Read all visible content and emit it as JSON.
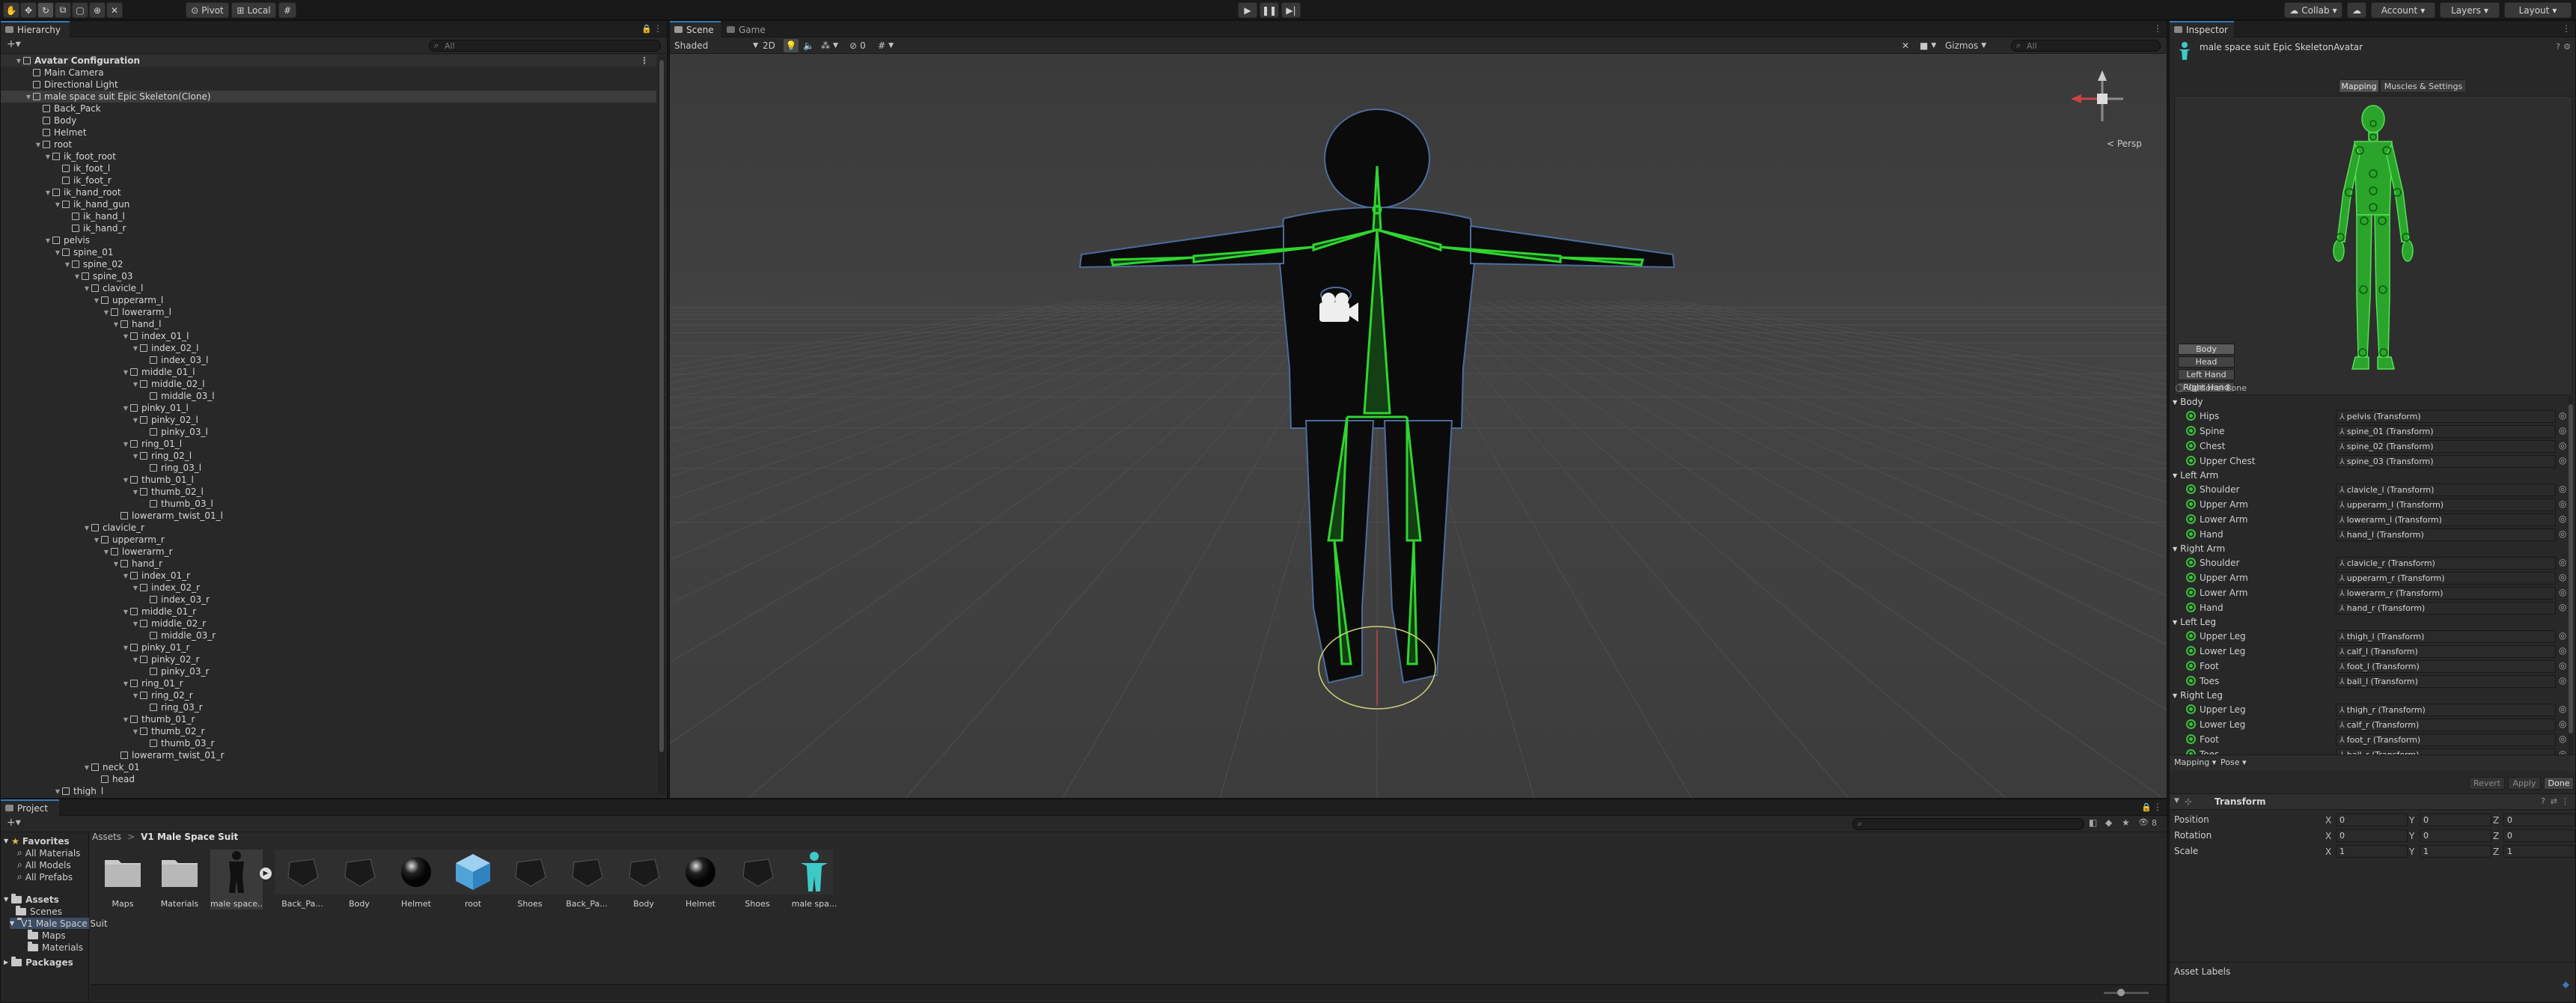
{
  "toolbar": {
    "pivot": "Pivot",
    "local": "Local",
    "collab": "Collab",
    "account": "Account",
    "layers": "Layers",
    "layout": "Layout"
  },
  "hierarchy": {
    "tab": "Hierarchy",
    "search_placeholder": "All",
    "rows": [
      {
        "label": "Avatar Configuration",
        "depth": 0,
        "arrow": "▼",
        "type": "root"
      },
      {
        "label": "Main Camera",
        "depth": 1,
        "arrow": ""
      },
      {
        "label": "Directional Light",
        "depth": 1,
        "arrow": ""
      },
      {
        "label": "male space suit Epic Skeleton(Clone)",
        "depth": 1,
        "arrow": "▼",
        "type": "sel"
      },
      {
        "label": "Back_Pack",
        "depth": 2,
        "arrow": ""
      },
      {
        "label": "Body",
        "depth": 2,
        "arrow": ""
      },
      {
        "label": "Helmet",
        "depth": 2,
        "arrow": ""
      },
      {
        "label": "root",
        "depth": 2,
        "arrow": "▼"
      },
      {
        "label": "ik_foot_root",
        "depth": 3,
        "arrow": "▼"
      },
      {
        "label": "ik_foot_l",
        "depth": 4,
        "arrow": ""
      },
      {
        "label": "ik_foot_r",
        "depth": 4,
        "arrow": ""
      },
      {
        "label": "ik_hand_root",
        "depth": 3,
        "arrow": "▼"
      },
      {
        "label": "ik_hand_gun",
        "depth": 4,
        "arrow": "▼"
      },
      {
        "label": "ik_hand_l",
        "depth": 5,
        "arrow": ""
      },
      {
        "label": "ik_hand_r",
        "depth": 5,
        "arrow": ""
      },
      {
        "label": "pelvis",
        "depth": 3,
        "arrow": "▼"
      },
      {
        "label": "spine_01",
        "depth": 4,
        "arrow": "▼"
      },
      {
        "label": "spine_02",
        "depth": 5,
        "arrow": "▼"
      },
      {
        "label": "spine_03",
        "depth": 6,
        "arrow": "▼"
      },
      {
        "label": "clavicle_l",
        "depth": 7,
        "arrow": "▼"
      },
      {
        "label": "upperarm_l",
        "depth": 8,
        "arrow": "▼"
      },
      {
        "label": "lowerarm_l",
        "depth": 9,
        "arrow": "▼"
      },
      {
        "label": "hand_l",
        "depth": 10,
        "arrow": "▼"
      },
      {
        "label": "index_01_l",
        "depth": 11,
        "arrow": "▼"
      },
      {
        "label": "index_02_l",
        "depth": 12,
        "arrow": "▼"
      },
      {
        "label": "index_03_l",
        "depth": 13,
        "arrow": ""
      },
      {
        "label": "middle_01_l",
        "depth": 11,
        "arrow": "▼"
      },
      {
        "label": "middle_02_l",
        "depth": 12,
        "arrow": "▼"
      },
      {
        "label": "middle_03_l",
        "depth": 13,
        "arrow": ""
      },
      {
        "label": "pinky_01_l",
        "depth": 11,
        "arrow": "▼"
      },
      {
        "label": "pinky_02_l",
        "depth": 12,
        "arrow": "▼"
      },
      {
        "label": "pinky_03_l",
        "depth": 13,
        "arrow": ""
      },
      {
        "label": "ring_01_l",
        "depth": 11,
        "arrow": "▼"
      },
      {
        "label": "ring_02_l",
        "depth": 12,
        "arrow": "▼"
      },
      {
        "label": "ring_03_l",
        "depth": 13,
        "arrow": ""
      },
      {
        "label": "thumb_01_l",
        "depth": 11,
        "arrow": "▼"
      },
      {
        "label": "thumb_02_l",
        "depth": 12,
        "arrow": "▼"
      },
      {
        "label": "thumb_03_l",
        "depth": 13,
        "arrow": ""
      },
      {
        "label": "lowerarm_twist_01_l",
        "depth": 10,
        "arrow": ""
      },
      {
        "label": "clavicle_r",
        "depth": 7,
        "arrow": "▼"
      },
      {
        "label": "upperarm_r",
        "depth": 8,
        "arrow": "▼"
      },
      {
        "label": "lowerarm_r",
        "depth": 9,
        "arrow": "▼"
      },
      {
        "label": "hand_r",
        "depth": 10,
        "arrow": "▼"
      },
      {
        "label": "index_01_r",
        "depth": 11,
        "arrow": "▼"
      },
      {
        "label": "index_02_r",
        "depth": 12,
        "arrow": "▼"
      },
      {
        "label": "index_03_r",
        "depth": 13,
        "arrow": ""
      },
      {
        "label": "middle_01_r",
        "depth": 11,
        "arrow": "▼"
      },
      {
        "label": "middle_02_r",
        "depth": 12,
        "arrow": "▼"
      },
      {
        "label": "middle_03_r",
        "depth": 13,
        "arrow": ""
      },
      {
        "label": "pinky_01_r",
        "depth": 11,
        "arrow": "▼"
      },
      {
        "label": "pinky_02_r",
        "depth": 12,
        "arrow": "▼"
      },
      {
        "label": "pinky_03_r",
        "depth": 13,
        "arrow": ""
      },
      {
        "label": "ring_01_r",
        "depth": 11,
        "arrow": "▼"
      },
      {
        "label": "ring_02_r",
        "depth": 12,
        "arrow": "▼"
      },
      {
        "label": "ring_03_r",
        "depth": 13,
        "arrow": ""
      },
      {
        "label": "thumb_01_r",
        "depth": 11,
        "arrow": "▼"
      },
      {
        "label": "thumb_02_r",
        "depth": 12,
        "arrow": "▼"
      },
      {
        "label": "thumb_03_r",
        "depth": 13,
        "arrow": ""
      },
      {
        "label": "lowerarm_twist_01_r",
        "depth": 10,
        "arrow": ""
      },
      {
        "label": "neck_01",
        "depth": 7,
        "arrow": "▼"
      },
      {
        "label": "head",
        "depth": 8,
        "arrow": ""
      },
      {
        "label": "thigh_l",
        "depth": 4,
        "arrow": "▼"
      }
    ]
  },
  "scene": {
    "tab_scene": "Scene",
    "tab_game": "Game",
    "shading": "Shaded",
    "mode_2d": "2D",
    "gizmos": "Gizmos",
    "search_placeholder": "All",
    "persp": "< Persp",
    "fx_count": "0",
    "grid_color": "#3b3b3b",
    "bone_color": "#2fd62f"
  },
  "inspector": {
    "tab": "Inspector",
    "title": "male space suit Epic SkeletonAvatar",
    "tab_mapping": "Mapping",
    "tab_muscles": "Muscles & Settings",
    "body_buttons": [
      "Body",
      "Head",
      "Left Hand",
      "Right Hand"
    ],
    "optional_bone": "Optional Bone",
    "groups": [
      {
        "name": "Body",
        "bones": [
          {
            "label": "Hips",
            "value": "pelvis (Transform)"
          },
          {
            "label": "Spine",
            "value": "spine_01 (Transform)"
          },
          {
            "label": "Chest",
            "value": "spine_02 (Transform)"
          },
          {
            "label": "Upper Chest",
            "value": "spine_03 (Transform)"
          }
        ]
      },
      {
        "name": "Left Arm",
        "bones": [
          {
            "label": "Shoulder",
            "value": "clavicle_l (Transform)"
          },
          {
            "label": "Upper Arm",
            "value": "upperarm_l (Transform)"
          },
          {
            "label": "Lower Arm",
            "value": "lowerarm_l (Transform)"
          },
          {
            "label": "Hand",
            "value": "hand_l (Transform)"
          }
        ]
      },
      {
        "name": "Right Arm",
        "bones": [
          {
            "label": "Shoulder",
            "value": "clavicle_r (Transform)"
          },
          {
            "label": "Upper Arm",
            "value": "upperarm_r (Transform)"
          },
          {
            "label": "Lower Arm",
            "value": "lowerarm_r (Transform)"
          },
          {
            "label": "Hand",
            "value": "hand_r (Transform)"
          }
        ]
      },
      {
        "name": "Left Leg",
        "bones": [
          {
            "label": "Upper Leg",
            "value": "thigh_l (Transform)"
          },
          {
            "label": "Lower Leg",
            "value": "calf_l (Transform)"
          },
          {
            "label": "Foot",
            "value": "foot_l (Transform)"
          },
          {
            "label": "Toes",
            "value": "ball_l (Transform)"
          }
        ]
      },
      {
        "name": "Right Leg",
        "bones": [
          {
            "label": "Upper Leg",
            "value": "thigh_r (Transform)"
          },
          {
            "label": "Lower Leg",
            "value": "calf_r (Transform)"
          },
          {
            "label": "Foot",
            "value": "foot_r (Transform)"
          },
          {
            "label": "Toes",
            "value": "ball_r (Transform)"
          }
        ]
      }
    ],
    "bottom_mapping": "Mapping ▾",
    "bottom_pose": "Pose ▾",
    "revert": "Revert",
    "apply": "Apply",
    "done": "Done",
    "transform": {
      "title": "Transform",
      "rows": [
        {
          "label": "Position",
          "x": "0",
          "y": "0",
          "z": "0"
        },
        {
          "label": "Rotation",
          "x": "0",
          "y": "0",
          "z": "0"
        },
        {
          "label": "Scale",
          "x": "1",
          "y": "1",
          "z": "1"
        }
      ]
    },
    "asset_labels": "Asset Labels"
  },
  "project": {
    "tab": "Project",
    "search_placeholder": "",
    "breadcrumb": [
      "Assets",
      "V1 Male Space Suit"
    ],
    "favorites": {
      "title": "Favorites",
      "items": [
        "All Materials",
        "All Models",
        "All Prefabs"
      ]
    },
    "assets": {
      "title": "Assets",
      "items": [
        "Scenes",
        "V1 Male Space Suit",
        "Maps",
        "Materials"
      ]
    },
    "packages": "Packages",
    "tiles": [
      {
        "label": "Maps",
        "kind": "folder"
      },
      {
        "label": "Materials",
        "kind": "folder"
      },
      {
        "label": "male space...",
        "kind": "model"
      },
      {
        "label": "Back_Pa...",
        "kind": "mesh"
      },
      {
        "label": "Body",
        "kind": "mesh"
      },
      {
        "label": "Helmet",
        "kind": "sphere"
      },
      {
        "label": "root",
        "kind": "cube"
      },
      {
        "label": "Shoes",
        "kind": "mesh"
      },
      {
        "label": "Back_Pa...",
        "kind": "mesh"
      },
      {
        "label": "Body",
        "kind": "mesh"
      },
      {
        "label": "Helmet",
        "kind": "sphere"
      },
      {
        "label": "Shoes",
        "kind": "mesh"
      },
      {
        "label": "male spa...",
        "kind": "avatar"
      }
    ],
    "count": "8"
  }
}
